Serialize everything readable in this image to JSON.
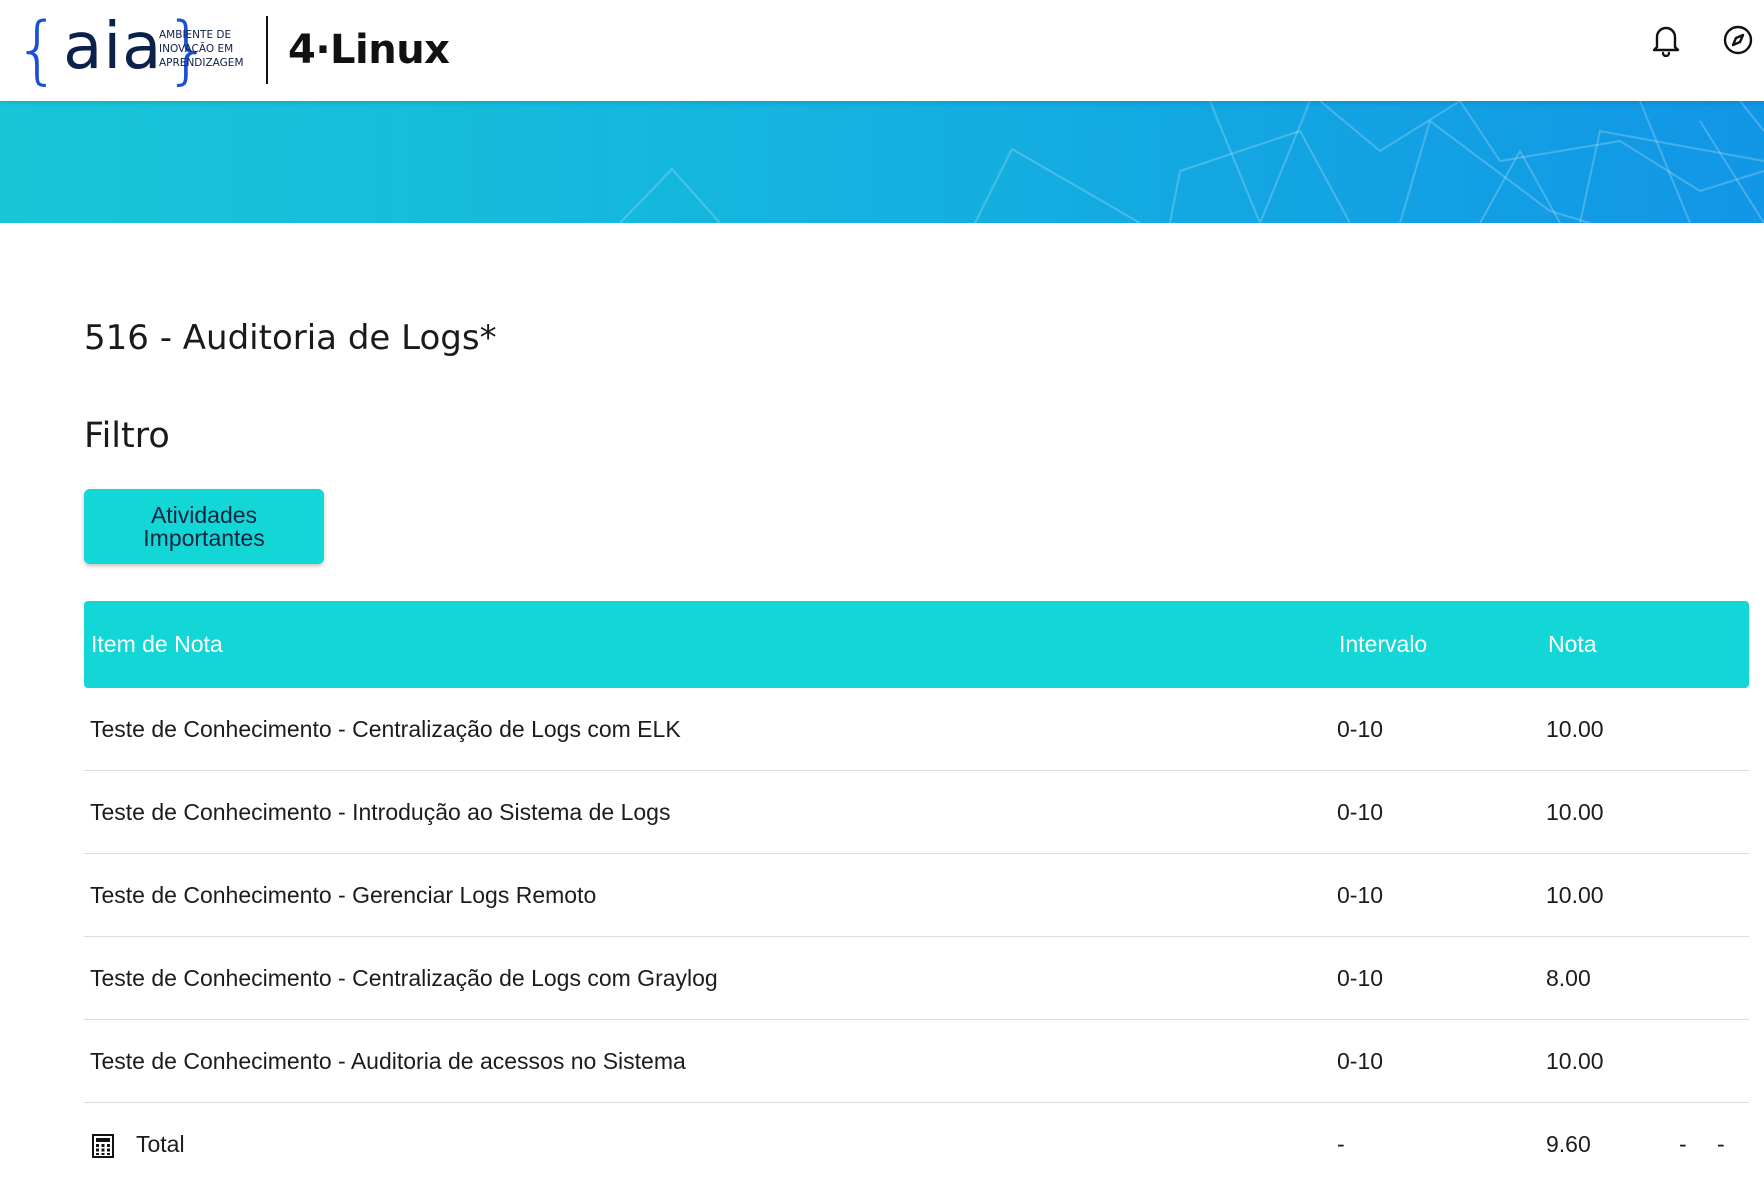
{
  "header": {
    "logo_aia": {
      "brace_open": "{",
      "word": "aia",
      "brace_close": "}",
      "tagline": [
        "AMBIENTE DE",
        "INOVAÇÃO EM",
        "APRENDIZAGEM"
      ]
    },
    "logo_partner": "4·Linux",
    "icons": [
      "bell-icon",
      "compass-icon"
    ]
  },
  "page": {
    "title": "516 - Auditoria de Logs*",
    "filter_heading": "Filtro",
    "filter_button": "Atividades Importantes"
  },
  "table": {
    "headers": {
      "item": "Item de Nota",
      "interval": "Intervalo",
      "grade": "Nota"
    },
    "rows": [
      {
        "item": "Teste de Conhecimento - Centralização de Logs com ELK",
        "interval": "0-10",
        "grade": "10.00"
      },
      {
        "item": "Teste de Conhecimento - Introdução ao Sistema de Logs",
        "interval": "0-10",
        "grade": "10.00"
      },
      {
        "item": "Teste de Conhecimento - Gerenciar Logs Remoto",
        "interval": "0-10",
        "grade": "10.00"
      },
      {
        "item": "Teste de Conhecimento - Centralização de Logs com Graylog",
        "interval": "0-10",
        "grade": "8.00"
      },
      {
        "item": "Teste de Conhecimento - Auditoria de acessos no Sistema",
        "interval": "0-10",
        "grade": "10.00"
      }
    ],
    "total": {
      "label": "Total",
      "interval": "-",
      "grade": "9.60",
      "extra_1": "-",
      "extra_2": "-"
    }
  },
  "colors": {
    "accent_teal": "#13d6d6",
    "banner_start": "#18c6d8",
    "banner_end": "#1296e6",
    "logo_blue": "#1b4fd8",
    "logo_navy": "#0b2149"
  }
}
